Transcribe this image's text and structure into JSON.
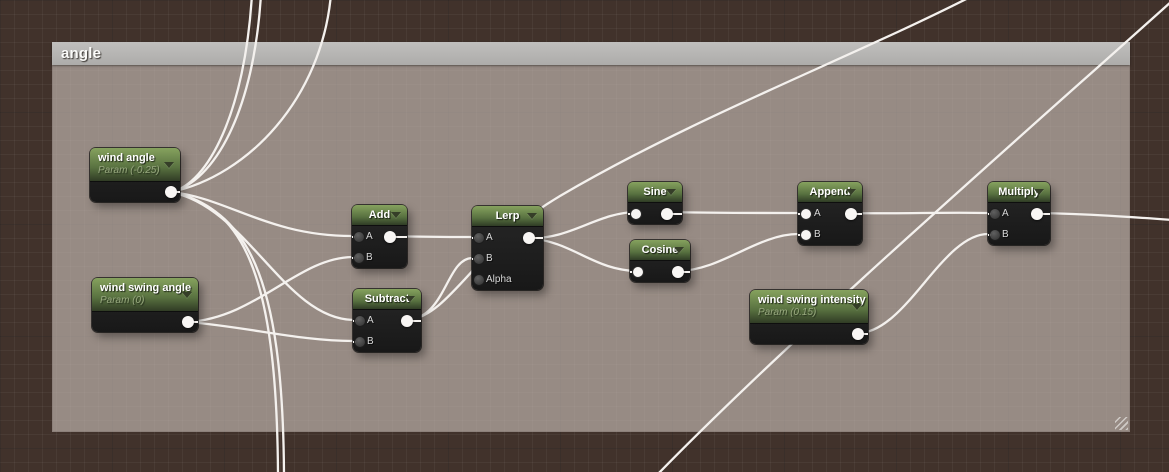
{
  "comment": {
    "title": "angle"
  },
  "nodes": {
    "wind_angle": {
      "title": "wind angle",
      "subtitle": "Param (-0.25)"
    },
    "wind_swing_angle": {
      "title": "wind swing angle",
      "subtitle": "Param (0)"
    },
    "wind_swing_intensity": {
      "title": "wind swing intensity",
      "subtitle": "Param (0.15)"
    },
    "add": {
      "title": "Add",
      "inputs": [
        "A",
        "B"
      ]
    },
    "subtract": {
      "title": "Subtract",
      "inputs": [
        "A",
        "B"
      ]
    },
    "lerp": {
      "title": "Lerp",
      "inputs": [
        "A",
        "B",
        "Alpha"
      ]
    },
    "sine": {
      "title": "Sine"
    },
    "cosine": {
      "title": "Cosine"
    },
    "append": {
      "title": "Append",
      "inputs": [
        "A",
        "B"
      ]
    },
    "multiply": {
      "title": "Multiply",
      "inputs": [
        "A",
        "B"
      ]
    }
  },
  "colors": {
    "canvas_bg": "#41322b",
    "comment_fill": "#948b84",
    "comment_header": "#b5b4b2",
    "node_header_green": "#6f8c4c",
    "node_body": "#1e1e1e",
    "wire": "#f4f1ee"
  }
}
